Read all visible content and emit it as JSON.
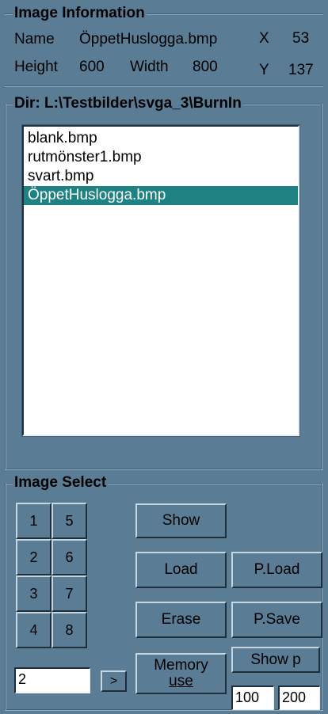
{
  "image_info": {
    "title": "Image Information",
    "name_label": "Name",
    "name_value": "ÖppetHuslogga.bmp",
    "x_label": "X",
    "x_value": "53",
    "height_label": "Height",
    "height_value": "600",
    "width_label": "Width",
    "width_value": "800",
    "y_label": "Y",
    "y_value": "137"
  },
  "dir": {
    "title": "Dir: L:\\Testbilder\\svga_3\\BurnIn",
    "files": [
      {
        "label": "blank.bmp",
        "selected": false
      },
      {
        "label": "rutmönster1.bmp",
        "selected": false
      },
      {
        "label": "svart.bmp",
        "selected": false
      },
      {
        "label": "ÖppetHuslogga.bmp",
        "selected": true
      }
    ]
  },
  "image_select": {
    "title": "Image Select",
    "numbers": [
      "1",
      "5",
      "2",
      "6",
      "3",
      "7",
      "4",
      "8"
    ],
    "show_label": "Show",
    "load_label": "Load",
    "pload_label": "P.Load",
    "erase_label": "Erase",
    "psave_label": "P.Save",
    "memory_label_1": "Memory",
    "memory_label_2": "use",
    "showp_label": "Show p",
    "index_value": "2",
    "next_label": ">",
    "field_a_value": "100",
    "field_b_value": "200"
  }
}
